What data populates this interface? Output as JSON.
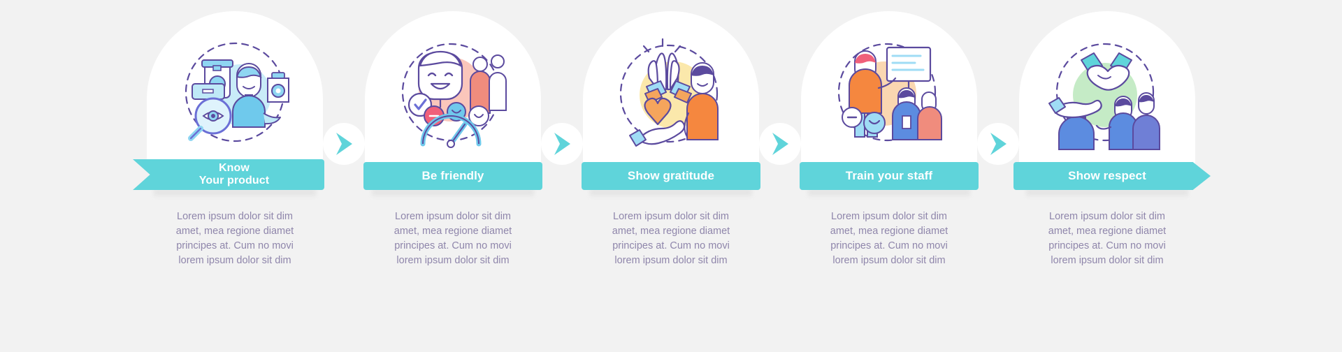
{
  "theme": {
    "background": "#f2f2f2",
    "card": "#ffffff",
    "accent": "#5fd4da",
    "label_text": "#ffffff",
    "body_text": "#8f86ab",
    "line_art_outline": "#5b4a9e"
  },
  "steps": [
    {
      "index": 1,
      "label": "Know\nYour product",
      "label_plain": "Know Your product",
      "icon_name": "product-knowledge-icon",
      "icon_accent": "#bfe9f7",
      "body": "Lorem ipsum dolor sit dim\namet, mea regione diamet\nprincipes at. Cum no movi\nlorem ipsum dolor sit dim"
    },
    {
      "index": 2,
      "label": "Be friendly",
      "label_plain": "Be friendly",
      "icon_name": "friendly-smile-satisfaction-icon",
      "icon_accent": "#f9c0b4",
      "body": "Lorem ipsum dolor sit dim\namet, mea regione diamet\nprincipes at. Cum no movi\nlorem ipsum dolor sit dim"
    },
    {
      "index": 3,
      "label": "Show gratitude",
      "label_plain": "Show gratitude",
      "icon_name": "gratitude-praying-hands-heart-icon",
      "icon_accent": "#fbe7a6",
      "body": "Lorem ipsum dolor sit dim\namet, mea regione diamet\nprincipes at. Cum no movi\nlorem ipsum dolor sit dim"
    },
    {
      "index": 4,
      "label": "Train your staff",
      "label_plain": "Train your staff",
      "icon_name": "staff-training-presentation-icon",
      "icon_accent": "#f9d3a8",
      "body": "Lorem ipsum dolor sit dim\namet, mea regione diamet\nprincipes at. Cum no movi\nlorem ipsum dolor sit dim"
    },
    {
      "index": 5,
      "label": "Show respect",
      "label_plain": "Show respect",
      "icon_name": "respect-handshake-icon",
      "icon_accent": "#bfe9c0",
      "body": "Lorem ipsum dolor sit dim\namet, mea regione diamet\nprincipes at. Cum no movi\nlorem ipsum dolor sit dim"
    }
  ],
  "connectors": [
    {
      "icon_name": "chevron-right-arrow-icon"
    },
    {
      "icon_name": "chevron-right-arrow-icon"
    },
    {
      "icon_name": "chevron-right-arrow-icon"
    },
    {
      "icon_name": "chevron-right-arrow-icon"
    }
  ]
}
